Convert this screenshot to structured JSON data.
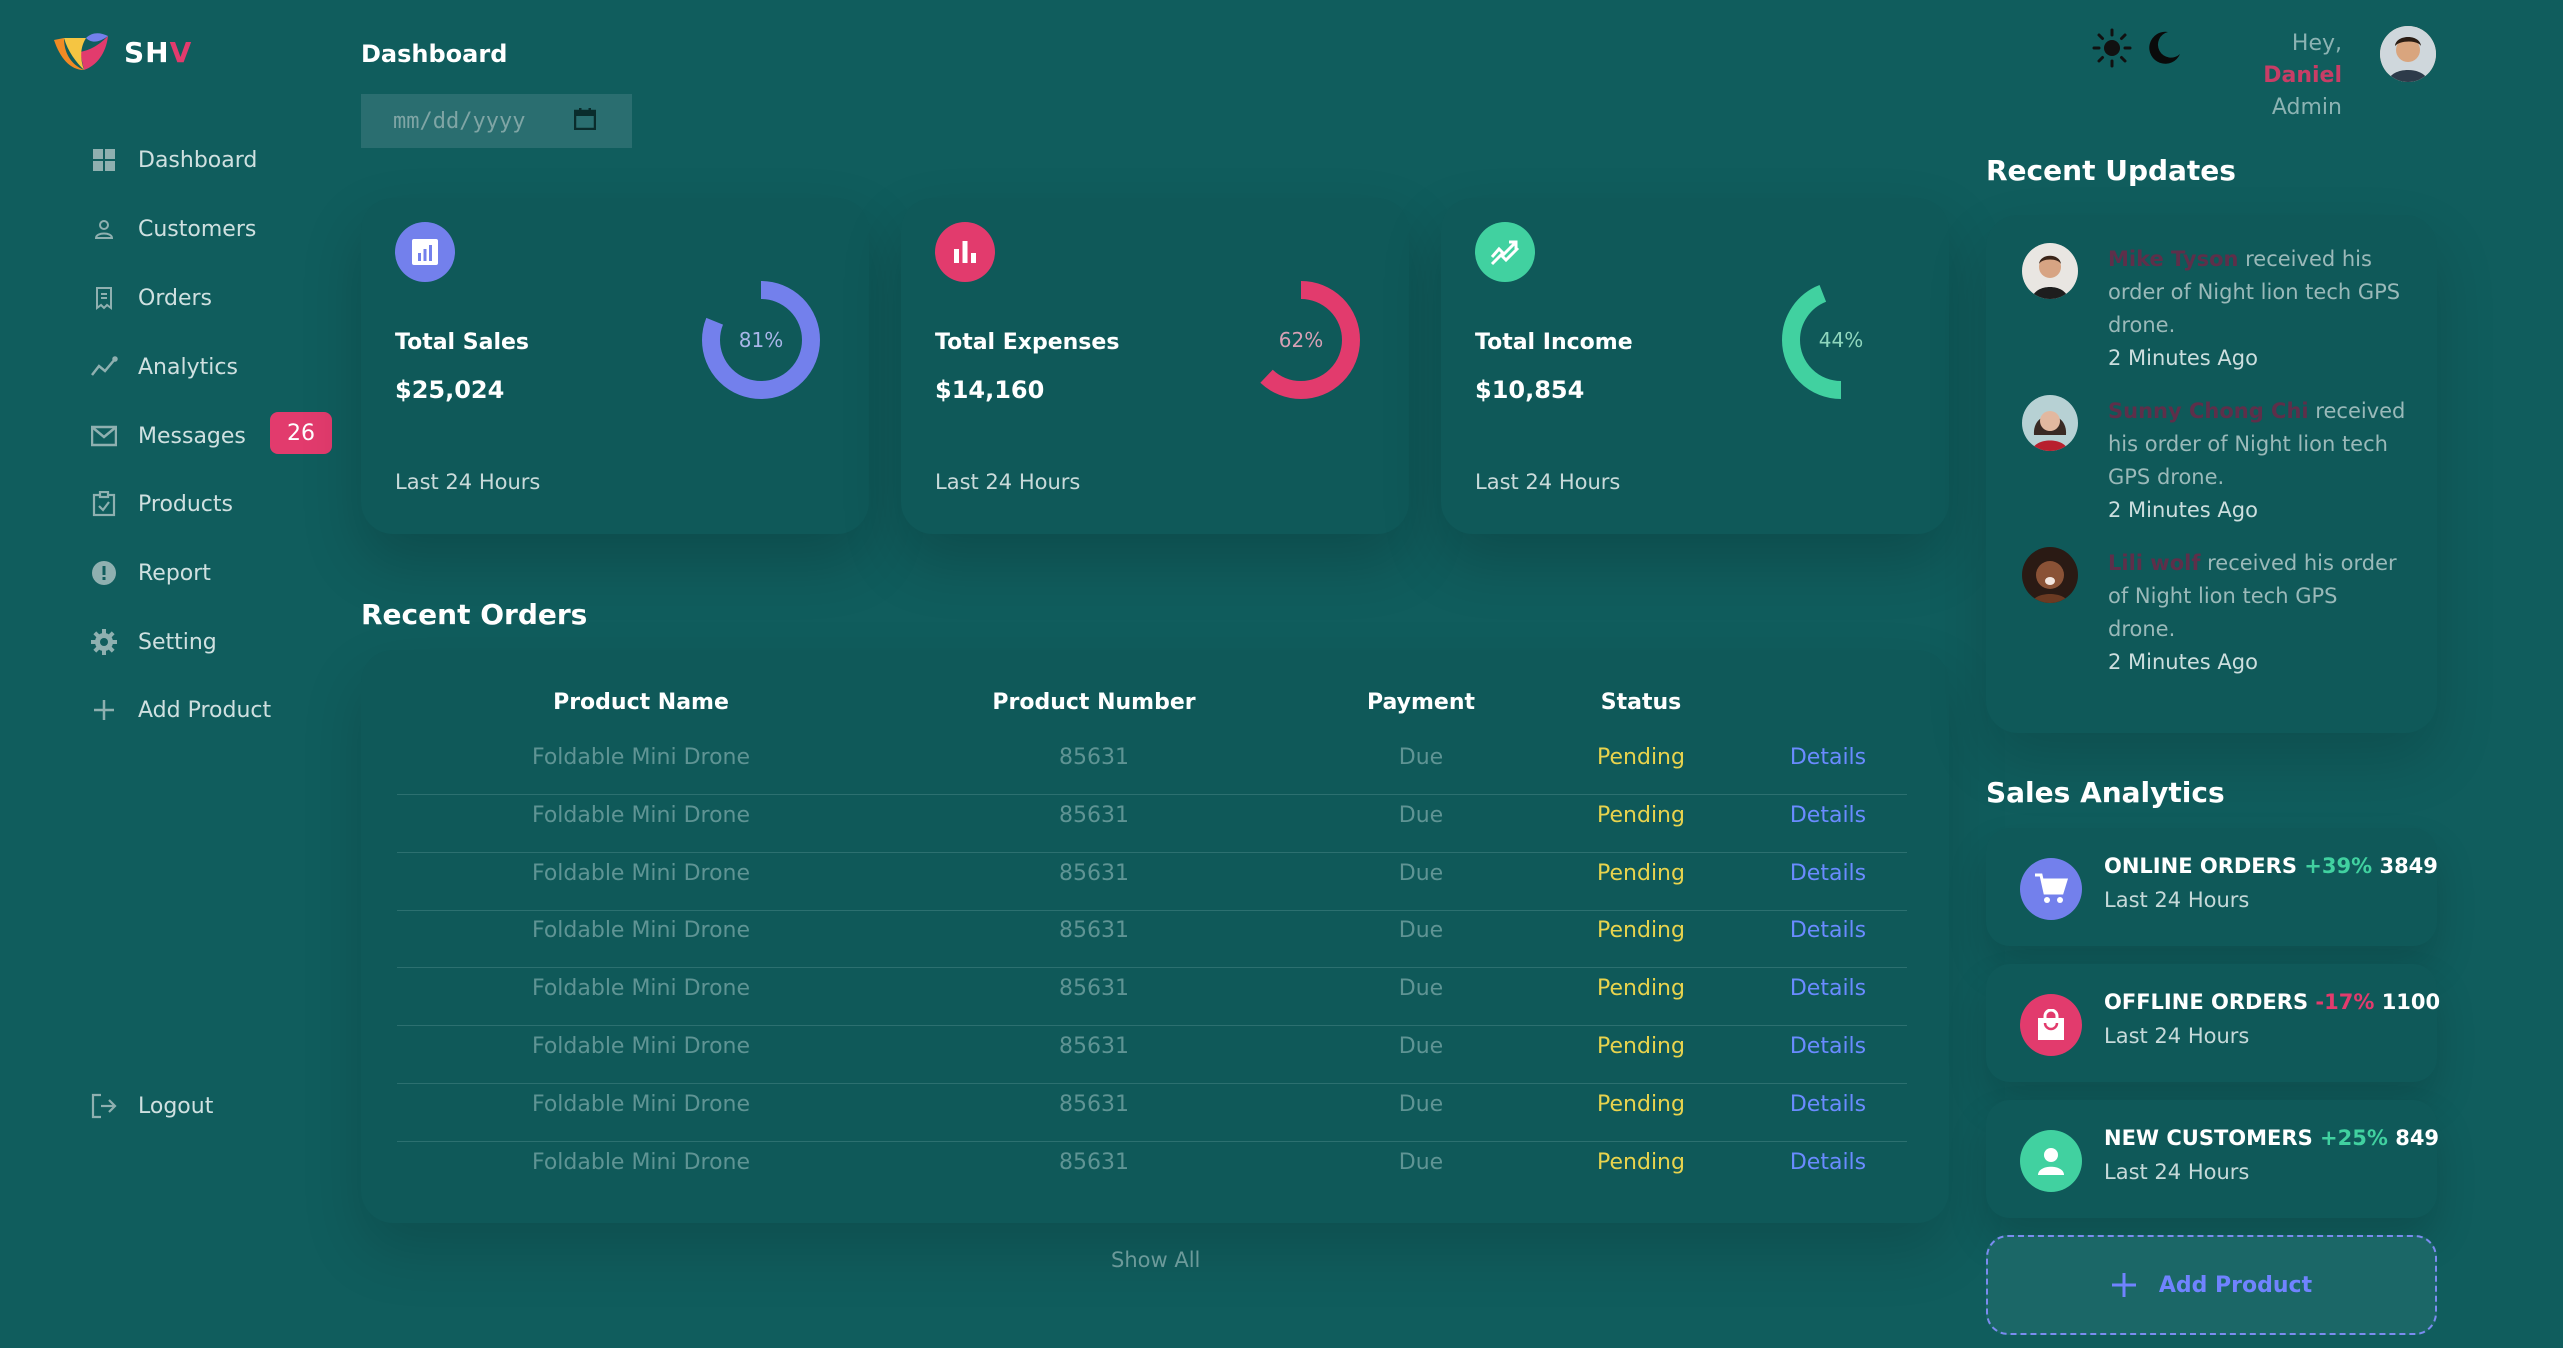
{
  "app": {
    "name_main": "SH",
    "name_accent": "V"
  },
  "sidebar": {
    "items": [
      {
        "label": "Dashboard",
        "icon": "grid-icon"
      },
      {
        "label": "Customers",
        "icon": "person-icon"
      },
      {
        "label": "Orders",
        "icon": "receipt-icon"
      },
      {
        "label": "Analytics",
        "icon": "analytics-icon"
      },
      {
        "label": "Messages",
        "icon": "mail-icon",
        "badge": "26"
      },
      {
        "label": "Products",
        "icon": "inventory-icon"
      },
      {
        "label": "Report",
        "icon": "report-icon"
      },
      {
        "label": "Setting",
        "icon": "gear-icon"
      },
      {
        "label": "Add Product",
        "icon": "plus-icon"
      }
    ],
    "logout": "Logout"
  },
  "header": {
    "title": "Dashboard",
    "date_placeholder": "mm/dd/yyyy",
    "greeting": "Hey, ",
    "user_name": "Daniel",
    "user_role": "Admin"
  },
  "insights": [
    {
      "title": "Total Sales",
      "value": "$25,024",
      "percent_label": "81%",
      "percent": 0.81,
      "subtitle": "Last 24 Hours",
      "color": "#7380ec"
    },
    {
      "title": "Total Expenses",
      "value": "$14,160",
      "percent_label": "62%",
      "percent": 0.62,
      "subtitle": "Last 24 Hours",
      "color": "#e23b6d"
    },
    {
      "title": "Total Income",
      "value": "$10,854",
      "percent_label": "44%",
      "percent": 0.44,
      "subtitle": "Last 24 Hours",
      "color": "#41d1a0"
    }
  ],
  "recent_orders": {
    "title": "Recent Orders",
    "headers": [
      "Product Name",
      "Product Number",
      "Payment",
      "Status"
    ],
    "rows": [
      {
        "name": "Foldable Mini Drone",
        "number": "85631",
        "payment": "Due",
        "status": "Pending",
        "action": "Details"
      },
      {
        "name": "Foldable Mini Drone",
        "number": "85631",
        "payment": "Due",
        "status": "Pending",
        "action": "Details"
      },
      {
        "name": "Foldable Mini Drone",
        "number": "85631",
        "payment": "Due",
        "status": "Pending",
        "action": "Details"
      },
      {
        "name": "Foldable Mini Drone",
        "number": "85631",
        "payment": "Due",
        "status": "Pending",
        "action": "Details"
      },
      {
        "name": "Foldable Mini Drone",
        "number": "85631",
        "payment": "Due",
        "status": "Pending",
        "action": "Details"
      },
      {
        "name": "Foldable Mini Drone",
        "number": "85631",
        "payment": "Due",
        "status": "Pending",
        "action": "Details"
      },
      {
        "name": "Foldable Mini Drone",
        "number": "85631",
        "payment": "Due",
        "status": "Pending",
        "action": "Details"
      },
      {
        "name": "Foldable Mini Drone",
        "number": "85631",
        "payment": "Due",
        "status": "Pending",
        "action": "Details"
      }
    ],
    "show_all": "Show All"
  },
  "recent_updates": {
    "title": "Recent Updates",
    "items": [
      {
        "name": "Mike Tyson",
        "text": " received his order of Night lion tech GPS drone.",
        "time": "2 Minutes Ago"
      },
      {
        "name": "Sunny Chong Chi",
        "text": " received his order of Night lion tech GPS drone.",
        "time": "2 Minutes Ago"
      },
      {
        "name": "Lili wolf",
        "text": " received his order of Night lion tech GPS drone.",
        "time": "2 Minutes Ago"
      }
    ]
  },
  "sales_analytics": {
    "title": "Sales Analytics",
    "items": [
      {
        "title": "ONLINE ORDERS",
        "change": "+39%",
        "value": "3849",
        "subtitle": "Last 24 Hours",
        "icon": "cart-icon",
        "color": "#7380ec"
      },
      {
        "title": "OFFLINE ORDERS",
        "change": "-17%",
        "value": "1100",
        "subtitle": "Last 24 Hours",
        "icon": "shopping-bag-icon",
        "color": "#e23b6d"
      },
      {
        "title": "NEW CUSTOMERS",
        "change": "+25%",
        "value": "849",
        "subtitle": "Last 24 Hours",
        "icon": "person-icon",
        "color": "#41d1a0"
      }
    ],
    "add_product": "Add Product"
  }
}
